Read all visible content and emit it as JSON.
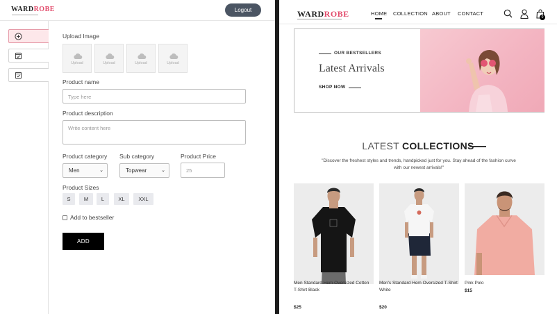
{
  "admin": {
    "logo_part1": "WARD",
    "logo_part2": "ROBE",
    "logout_label": "Logout",
    "sidebar": [
      {
        "icon": "add-circle-icon",
        "active": true
      },
      {
        "icon": "checklist-icon",
        "active": false
      },
      {
        "icon": "checklist-icon",
        "active": false
      }
    ],
    "form": {
      "upload_label": "Upload Image",
      "upload_placeholder": "Upload",
      "name_label": "Product name",
      "name_placeholder": "Type here",
      "description_label": "Product description",
      "description_placeholder": "Write content here",
      "category_label": "Product category",
      "category_value": "Men",
      "subcategory_label": "Sub category",
      "subcategory_value": "Topwear",
      "price_label": "Product Price",
      "price_placeholder": "25",
      "sizes_label": "Product Sizes",
      "sizes": [
        "S",
        "M",
        "L",
        "XL",
        "XXL"
      ],
      "bestseller_label": "Add to bestseller",
      "bestseller_checked": false,
      "add_label": "ADD"
    }
  },
  "store": {
    "logo_part1": "WARD",
    "logo_part2": "ROBE",
    "nav": [
      "HOME",
      "COLLECTION",
      "ABOUT",
      "CONTACT"
    ],
    "active_nav": "HOME",
    "cart_count": "0",
    "hero": {
      "eyebrow": "OUR BESTSELLERS",
      "title": "Latest Arrivals",
      "cta": "SHOP NOW"
    },
    "collections": {
      "title_light": "LATEST",
      "title_bold": "COLLECTIONS",
      "subtitle": "\"Discover the freshest styles and trends, handpicked just for you. Stay ahead of the fashion curve with our newest arrivals!\""
    },
    "products": [
      {
        "name": "Men Standard Hem Oversized Cotton T-Shirt Black",
        "price": "$25"
      },
      {
        "name": "Men's Standard Hem Oversized T-Shirt White",
        "price": "$20"
      },
      {
        "name": "Pink Polo",
        "price": "$15"
      }
    ]
  },
  "colors": {
    "brand_accent": "#e24b6b",
    "logout_bg": "#4b5563",
    "active_sidebar_bg": "#fde7ea",
    "hero_pink": "#f3b4c1",
    "add_button_bg": "#000000"
  }
}
